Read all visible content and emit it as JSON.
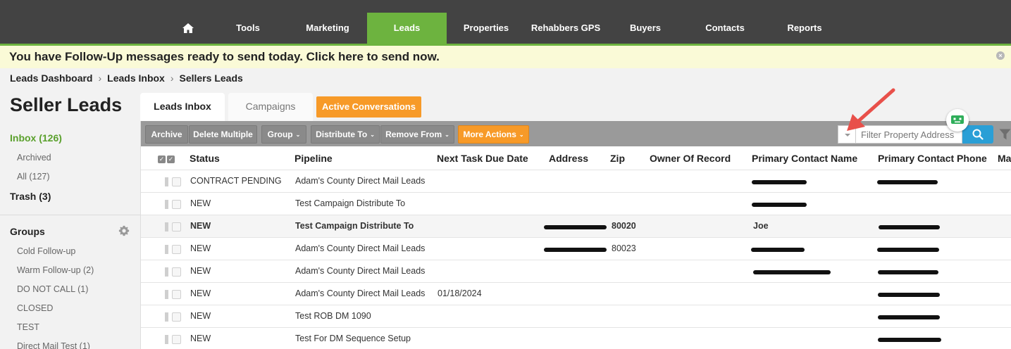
{
  "nav": {
    "items": [
      {
        "label": "Tools"
      },
      {
        "label": "Marketing"
      },
      {
        "label": "Leads"
      },
      {
        "label": "Properties"
      },
      {
        "label": "Rehabbers GPS"
      },
      {
        "label": "Buyers"
      },
      {
        "label": "Contacts"
      },
      {
        "label": "Reports"
      }
    ],
    "active": "Leads"
  },
  "banner": {
    "text": "You have Follow-Up messages ready to send today. Click here to send now.",
    "close_symbol": "×"
  },
  "breadcrumb": {
    "items": [
      "Leads Dashboard",
      "Leads Inbox",
      "Sellers Leads"
    ],
    "separator": "›"
  },
  "page": {
    "title": "Seller Leads"
  },
  "tabs": {
    "inbox": "Leads Inbox",
    "campaigns": "Campaigns",
    "active_conversations": "Active Conversations"
  },
  "sidebar": {
    "inbox": "Inbox (126)",
    "archived": "Archived",
    "all": "All (127)",
    "trash": "Trash (3)",
    "groups_title": "Groups",
    "groups": [
      "Cold Follow-up",
      "Warm Follow-up (2)",
      "DO NOT CALL (1)",
      "CLOSED",
      "TEST",
      "Direct Mail Test (1)"
    ]
  },
  "toolbar": {
    "archive": "Archive",
    "delete_multiple": "Delete Multiple",
    "group": "Group",
    "distribute_to": "Distribute To",
    "remove_from": "Remove From",
    "more_actions": "More Actions",
    "caret": "⌄",
    "filter_placeholder": "Filter Property Address"
  },
  "table": {
    "headers": {
      "status": "Status",
      "pipeline": "Pipeline",
      "next_task": "Next Task Due Date",
      "address": "Address",
      "zip": "Zip",
      "owner": "Owner Of Record",
      "contact_name": "Primary Contact Name",
      "contact_phone": "Primary Contact Phone",
      "more": "Ma"
    },
    "rows": [
      {
        "status": "CONTRACT PENDING",
        "pipeline": "Adam's County Direct Mail Leads",
        "next_task": "",
        "zip": "",
        "contact_name": ""
      },
      {
        "status": "NEW",
        "pipeline": "Test Campaign Distribute To",
        "next_task": "",
        "zip": "",
        "contact_name": ""
      },
      {
        "status": "NEW",
        "pipeline": "Test Campaign Distribute To",
        "next_task": "",
        "zip": "80020",
        "contact_name": "Joe"
      },
      {
        "status": "NEW",
        "pipeline": "Adam's County Direct Mail Leads",
        "next_task": "",
        "zip": "80023",
        "contact_name": ""
      },
      {
        "status": "NEW",
        "pipeline": "Adam's County Direct Mail Leads",
        "next_task": "",
        "zip": "",
        "contact_name": ""
      },
      {
        "status": "NEW",
        "pipeline": "Adam's County Direct Mail Leads",
        "next_task": "01/18/2024",
        "zip": "",
        "contact_name": ""
      },
      {
        "status": "NEW",
        "pipeline": "Test ROB DM 1090",
        "next_task": "",
        "zip": "",
        "contact_name": ""
      },
      {
        "status": "NEW",
        "pipeline": "Test For DM Sequence Setup",
        "next_task": "",
        "zip": "",
        "contact_name": ""
      }
    ]
  },
  "colors": {
    "nav_bg": "#434343",
    "accent_green": "#6db33f",
    "orange": "#f79a28",
    "search_blue": "#2a9fd6",
    "annotation_arrow": "#e8504a"
  }
}
